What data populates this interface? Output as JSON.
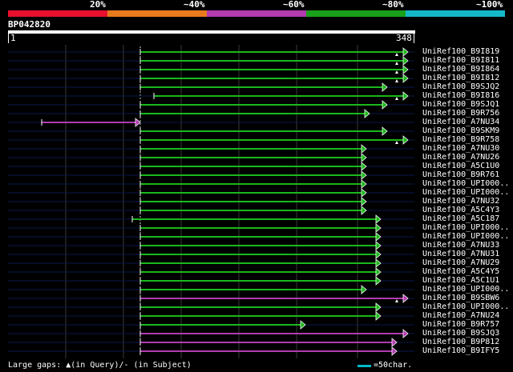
{
  "legend": {
    "labels": [
      "20%",
      "~40%",
      "~60%",
      "~80%",
      "~100%"
    ],
    "colors": [
      "#e8102e",
      "#e87a1e",
      "#b23bb0",
      "#1aa01a",
      "#14b8c8"
    ]
  },
  "query": {
    "name": "BP042820",
    "start": "1",
    "end": "348"
  },
  "hits": [
    {
      "label": "UniRef100_B9I819",
      "start": 175,
      "end": 509,
      "color": "green",
      "mark": true
    },
    {
      "label": "UniRef100_B9I811",
      "start": 175,
      "end": 509,
      "color": "green",
      "mark": true
    },
    {
      "label": "UniRef100_B9I864",
      "start": 175,
      "end": 509,
      "color": "green",
      "mark": true
    },
    {
      "label": "UniRef100_B9I812",
      "start": 175,
      "end": 509,
      "color": "green",
      "mark": true
    },
    {
      "label": "UniRef100_B9SJQ2",
      "start": 175,
      "end": 483,
      "color": "green",
      "mark": false
    },
    {
      "label": "UniRef100_B9I816",
      "start": 192,
      "end": 509,
      "color": "green",
      "mark": true
    },
    {
      "label": "UniRef100_B9SJQ1",
      "start": 175,
      "end": 483,
      "color": "green",
      "mark": false
    },
    {
      "label": "UniRef100_B9R756",
      "start": 175,
      "end": 461,
      "color": "green",
      "mark": false
    },
    {
      "label": "UniRef100_A7NU34",
      "start": 52,
      "end": 175,
      "color": "magenta",
      "mark": false
    },
    {
      "label": "UniRef100_B9SKM9",
      "start": 175,
      "end": 483,
      "color": "green",
      "mark": false
    },
    {
      "label": "UniRef100_B9R758",
      "start": 175,
      "end": 509,
      "color": "green",
      "mark": true
    },
    {
      "label": "UniRef100_A7NU30",
      "start": 175,
      "end": 457,
      "color": "green",
      "mark": false
    },
    {
      "label": "UniRef100_A7NU26",
      "start": 175,
      "end": 457,
      "color": "green",
      "mark": false
    },
    {
      "label": "UniRef100_A5C1U0",
      "start": 175,
      "end": 457,
      "color": "green",
      "mark": false
    },
    {
      "label": "UniRef100_B9R761",
      "start": 175,
      "end": 457,
      "color": "green",
      "mark": false
    },
    {
      "label": "UniRef100_UPI000..",
      "start": 175,
      "end": 457,
      "color": "green",
      "mark": false
    },
    {
      "label": "UniRef100_UPI000..",
      "start": 175,
      "end": 457,
      "color": "green",
      "mark": false
    },
    {
      "label": "UniRef100_A7NU32",
      "start": 175,
      "end": 457,
      "color": "green",
      "mark": false
    },
    {
      "label": "UniRef100_A5C4Y3",
      "start": 175,
      "end": 457,
      "color": "green",
      "mark": false
    },
    {
      "label": "UniRef100_A5C187",
      "start": 165,
      "end": 475,
      "color": "green",
      "mark": false
    },
    {
      "label": "UniRef100_UPI000..",
      "start": 175,
      "end": 475,
      "color": "green",
      "mark": false
    },
    {
      "label": "UniRef100_UPI000..",
      "start": 175,
      "end": 475,
      "color": "green",
      "mark": false
    },
    {
      "label": "UniRef100_A7NU33",
      "start": 175,
      "end": 475,
      "color": "green",
      "mark": false
    },
    {
      "label": "UniRef100_A7NU31",
      "start": 175,
      "end": 475,
      "color": "green",
      "mark": false
    },
    {
      "label": "UniRef100_A7NU29",
      "start": 175,
      "end": 475,
      "color": "green",
      "mark": false
    },
    {
      "label": "UniRef100_A5C4Y5",
      "start": 175,
      "end": 475,
      "color": "green",
      "mark": false
    },
    {
      "label": "UniRef100_A5C1U1",
      "start": 175,
      "end": 475,
      "color": "green",
      "mark": false
    },
    {
      "label": "UniRef100_UPI000..",
      "start": 175,
      "end": 457,
      "color": "green",
      "mark": false
    },
    {
      "label": "UniRef100_B9SBW6",
      "start": 175,
      "end": 509,
      "color": "magenta",
      "mark": true
    },
    {
      "label": "UniRef100_UPI000..",
      "start": 175,
      "end": 475,
      "color": "green",
      "mark": false
    },
    {
      "label": "UniRef100_A7NU24",
      "start": 175,
      "end": 475,
      "color": "green",
      "mark": false
    },
    {
      "label": "UniRef100_B9R757",
      "start": 175,
      "end": 381,
      "color": "green",
      "mark": false
    },
    {
      "label": "UniRef100_B9SJQ3",
      "start": 175,
      "end": 509,
      "color": "magenta",
      "mark": false
    },
    {
      "label": "UniRef100_B9P812",
      "start": 175,
      "end": 495,
      "color": "magenta",
      "mark": false
    },
    {
      "label": "UniRef100_B9IFY5",
      "start": 175,
      "end": 495,
      "color": "magenta",
      "mark": false
    }
  ],
  "footer": {
    "gaps_text": "Large gaps: ▲(in Query)/- (in Subject)",
    "scale_text": "=50char."
  }
}
